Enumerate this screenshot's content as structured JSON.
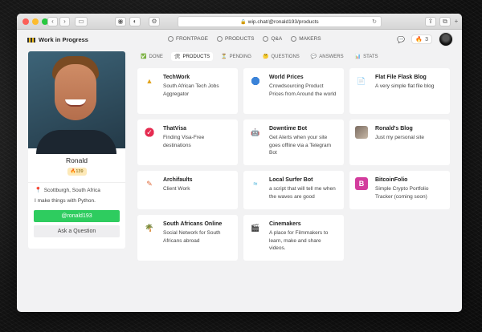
{
  "browser": {
    "url": "wip.chat/@ronald193/products",
    "back_icon": "chevron-left-icon",
    "forward_icon": "chevron-right-icon"
  },
  "header": {
    "brand": "Work in Progress",
    "nav": [
      {
        "label": "FRONTPAGE",
        "icon": "compass-icon"
      },
      {
        "label": "PRODUCTS",
        "icon": "cube-icon"
      },
      {
        "label": "Q&A",
        "icon": "chat-bubble-icon"
      },
      {
        "label": "MAKERS",
        "icon": "people-icon"
      }
    ],
    "streak": "3"
  },
  "profile": {
    "name": "Ronald",
    "badge": "139",
    "location": "Scottburgh, South Africa",
    "bio": "I make things with Python.",
    "handle_button": "@ronald193",
    "ask_button": "Ask a Question"
  },
  "tabs": [
    {
      "label": "DONE",
      "glyph": "✅"
    },
    {
      "label": "PRODUCTS",
      "glyph": "🛠"
    },
    {
      "label": "PENDING",
      "glyph": "⏳"
    },
    {
      "label": "QUESTIONS",
      "glyph": "🤔"
    },
    {
      "label": "ANSWERS",
      "glyph": "💬"
    },
    {
      "label": "STATS",
      "glyph": "📊"
    }
  ],
  "products": [
    {
      "title": "TechWork",
      "desc": "South African Tech Jobs Aggregator",
      "icon": "briefcase-icon"
    },
    {
      "title": "World Prices",
      "desc": "Crowdsourcing Product Prices from Around the world",
      "icon": "globe-icon"
    },
    {
      "title": "Flat File Flask Blog",
      "desc": "A very simple flat file blog",
      "icon": "document-icon"
    },
    {
      "title": "ThatVisa",
      "desc": "Finding Visa-Free destinations",
      "icon": "visa-logo-icon"
    },
    {
      "title": "Downtime Bot",
      "desc": "Get Alerts when your site goes offline via a Telegram Bot",
      "icon": "robot-icon"
    },
    {
      "title": "Ronald's Blog",
      "desc": "Just my personal site",
      "icon": "blog-thumbnail-icon"
    },
    {
      "title": "Archifaults",
      "desc": "Client Work",
      "icon": "pencil-icon"
    },
    {
      "title": "Local Surfer Bot",
      "desc": "a script that will tell me when the waves are good",
      "icon": "wave-icon"
    },
    {
      "title": "BitcoinFolio",
      "desc": "Simple Crypto Portfolio Tracker (coming soon)",
      "icon": "bitcoinfolio-logo-icon"
    },
    {
      "title": "South Africans Online",
      "desc": "Social Network for South Africans abroad",
      "icon": "palm-tree-icon"
    },
    {
      "title": "Cinemakers",
      "desc": "A place for Filmmakers to learn, make and share videos.",
      "icon": "clapperboard-icon"
    }
  ]
}
